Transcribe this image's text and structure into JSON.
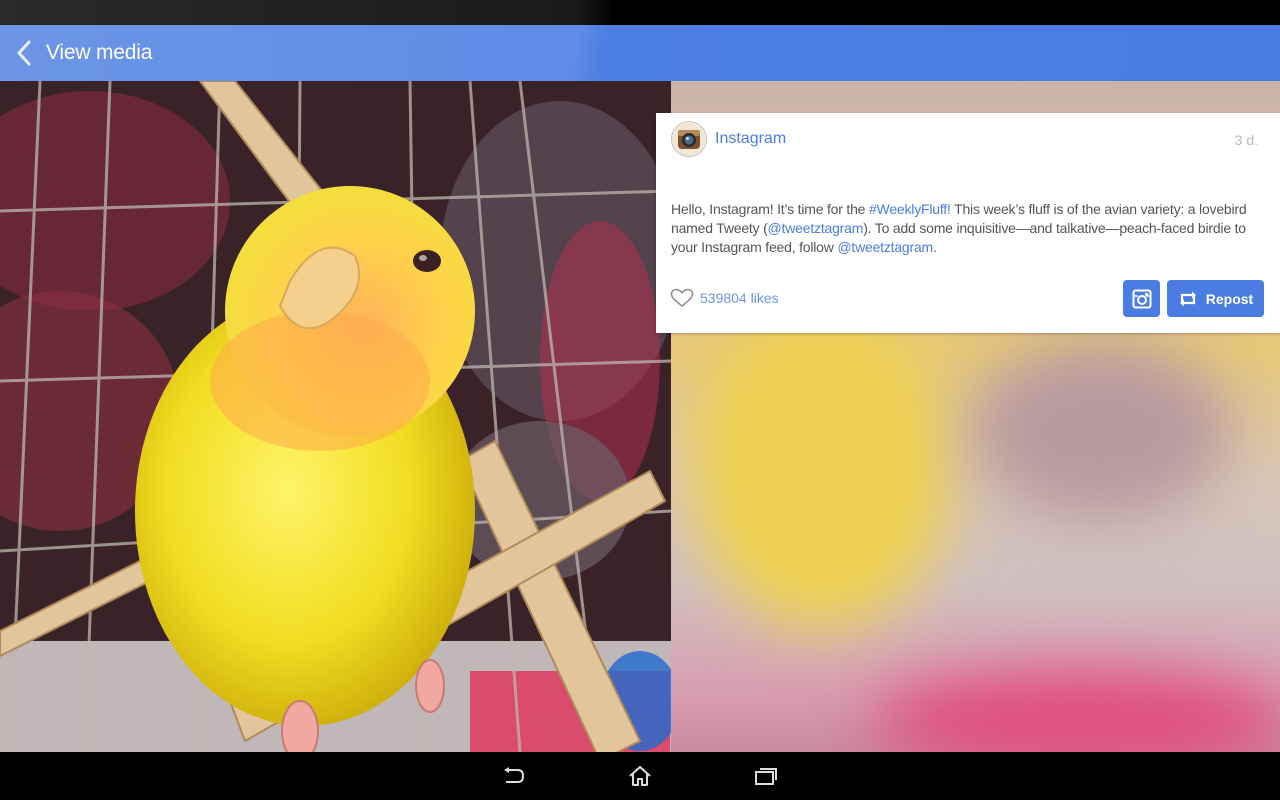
{
  "app_bar": {
    "back_icon": "chevron-left-icon",
    "title": "View media"
  },
  "post": {
    "avatar_icon": "instagram-logo-icon",
    "username": "Instagram",
    "timestamp": "3 d.",
    "caption": {
      "part1": "Hello, Instagram! It’s time for the ",
      "hashtag": "#WeeklyFluff!",
      "part2": " This week’s fluff is of the avian variety: a lovebird named Tweety (",
      "mention1": "@tweetztagram",
      "part3": "). To add some inquisitive—and talkative—peach-faced birdie to your Instagram feed, follow ",
      "mention2": "@tweetztagram",
      "part4": "."
    },
    "likes_icon": "heart-icon",
    "likes_count": "539804 likes",
    "instagram_button_icon": "instagram-icon",
    "repost_icon": "repost-icon",
    "repost_label": "Repost"
  },
  "nav_bar": {
    "back_icon": "back-arrow-icon",
    "home_icon": "home-icon",
    "recents_icon": "recent-apps-icon"
  },
  "colors": {
    "accent": "#4a7ce2",
    "link": "#4a7ce2",
    "text": "#555555",
    "timestamp": "#b9b9b9"
  }
}
